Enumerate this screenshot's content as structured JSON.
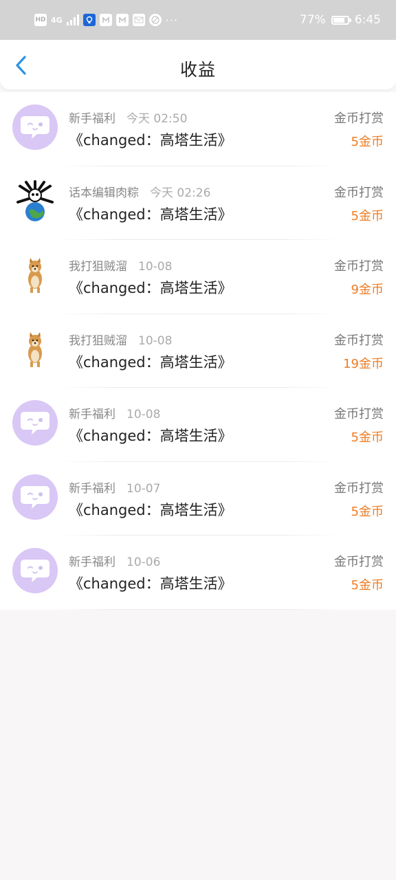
{
  "status_bar": {
    "left_icons": [
      "hd-icon",
      "4g-signal-icon",
      "bulb-app-icon",
      "app-icon",
      "app-icon",
      "mail-icon",
      "browser-icon"
    ],
    "hd": "HD",
    "signal": "4G",
    "more": "···",
    "battery": "77%",
    "time": "6:45"
  },
  "header": {
    "title": "收益",
    "back_icon": "chevron-left-icon"
  },
  "colors": {
    "amount": "#f07c22",
    "back": "#2a93e6",
    "avatar_bg": "#d9c7f5"
  },
  "records": [
    {
      "user": "新手福利",
      "time": "今天 02:50",
      "book": "《changed：高塔生活》",
      "type": "金币打赏",
      "amount": "5金币",
      "avatar": "chat-bubble"
    },
    {
      "user": "话本编辑肉粽",
      "time": "今天 02:26",
      "book": "《changed：高塔生活》",
      "type": "金币打赏",
      "amount": "5金币",
      "avatar": "skull-globe"
    },
    {
      "user": "我打狙贼溜",
      "time": "10-08",
      "book": "《changed：高塔生活》",
      "type": "金币打赏",
      "amount": "9金币",
      "avatar": "shiba-dog"
    },
    {
      "user": "我打狙贼溜",
      "time": "10-08",
      "book": "《changed：高塔生活》",
      "type": "金币打赏",
      "amount": "19金币",
      "avatar": "shiba-dog"
    },
    {
      "user": "新手福利",
      "time": "10-08",
      "book": "《changed：高塔生活》",
      "type": "金币打赏",
      "amount": "5金币",
      "avatar": "chat-bubble"
    },
    {
      "user": "新手福利",
      "time": "10-07",
      "book": "《changed：高塔生活》",
      "type": "金币打赏",
      "amount": "5金币",
      "avatar": "chat-bubble"
    },
    {
      "user": "新手福利",
      "time": "10-06",
      "book": "《changed：高塔生活》",
      "type": "金币打赏",
      "amount": "5金币",
      "avatar": "chat-bubble"
    }
  ]
}
